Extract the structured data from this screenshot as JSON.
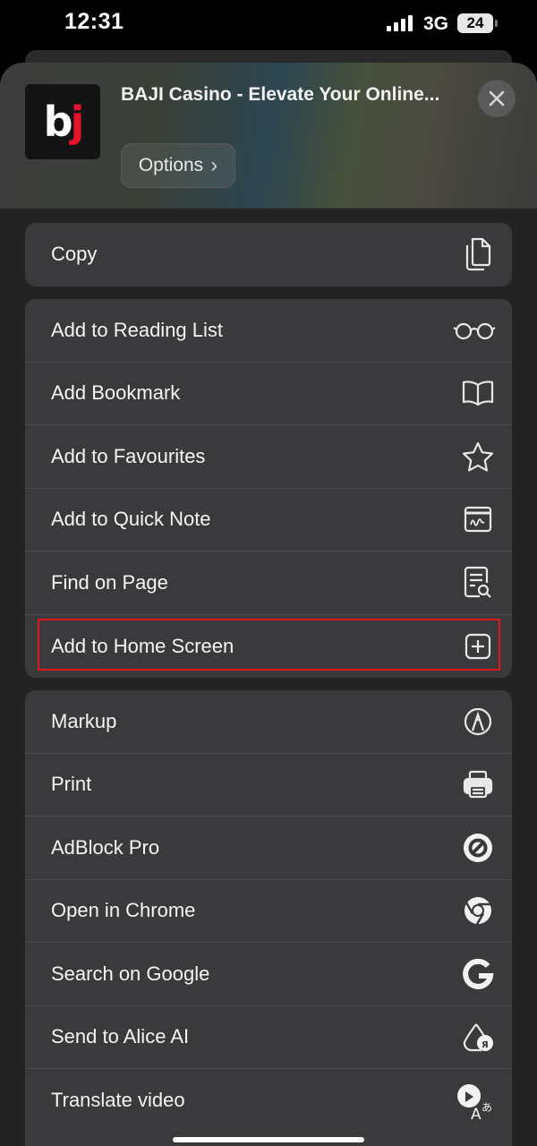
{
  "status_bar": {
    "time": "12:31",
    "network": "3G",
    "battery": "24"
  },
  "header": {
    "logo_b": "b",
    "logo_j": "j",
    "title": "BAJI Casino - Elevate Your Online...",
    "options_label": "Options",
    "options_chevron": "›"
  },
  "groups": [
    {
      "items": [
        {
          "label": "Copy",
          "icon": "copy-icon"
        }
      ]
    },
    {
      "items": [
        {
          "label": "Add to Reading List",
          "icon": "glasses-icon"
        },
        {
          "label": "Add Bookmark",
          "icon": "book-icon"
        },
        {
          "label": "Add to Favourites",
          "icon": "star-icon"
        },
        {
          "label": "Add to Quick Note",
          "icon": "quick-note-icon"
        },
        {
          "label": "Find on Page",
          "icon": "find-on-page-icon"
        },
        {
          "label": "Add to Home Screen",
          "icon": "plus-square-icon"
        }
      ]
    },
    {
      "items": [
        {
          "label": "Markup",
          "icon": "markup-icon"
        },
        {
          "label": "Print",
          "icon": "printer-icon"
        },
        {
          "label": "AdBlock Pro",
          "icon": "adblock-icon"
        },
        {
          "label": "Open in Chrome",
          "icon": "chrome-icon"
        },
        {
          "label": "Search on Google",
          "icon": "google-icon"
        },
        {
          "label": "Send to Alice AI",
          "icon": "alice-icon"
        },
        {
          "label": "Translate video",
          "icon": "translate-video-icon"
        }
      ]
    }
  ],
  "colors": {
    "highlight": "#e0161f",
    "logo_red": "#e3132b",
    "row_bg": "#3a3a3c"
  }
}
